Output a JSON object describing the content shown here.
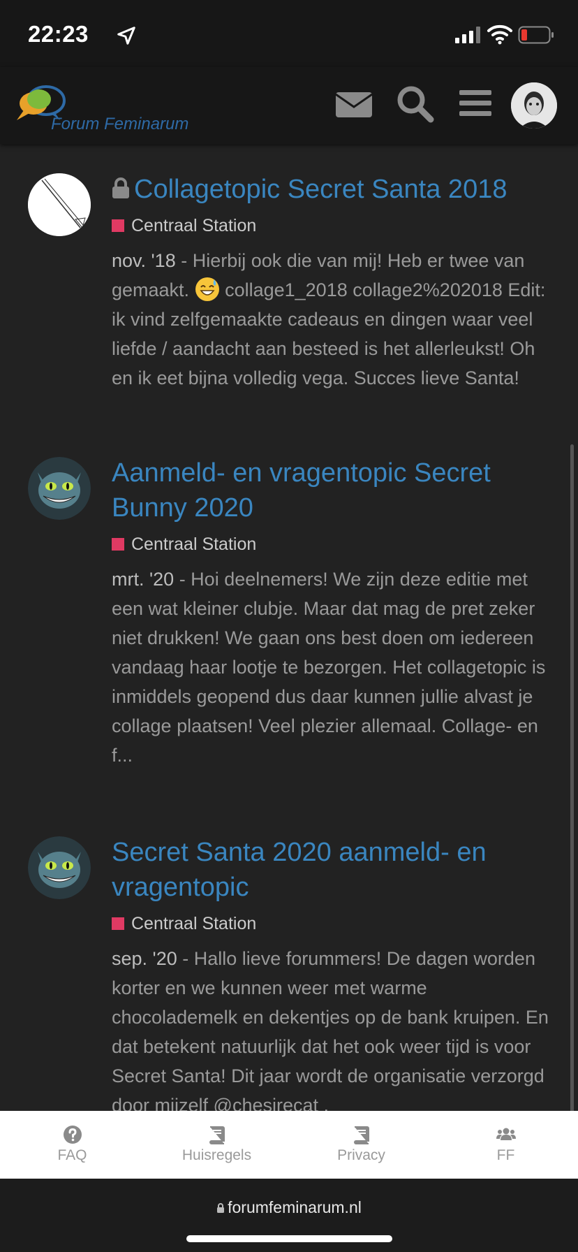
{
  "status_bar": {
    "time": "22:23",
    "icons": [
      "location-arrow-icon",
      "cellular-signal-icon",
      "wifi-icon",
      "battery-low-icon"
    ]
  },
  "header": {
    "logo_text": "Forum Feminarum",
    "icons": [
      "envelope-icon",
      "search-icon",
      "hamburger-menu-icon",
      "user-avatar"
    ]
  },
  "posts": [
    {
      "title": "Collagetopic Secret Santa 2018",
      "locked": true,
      "category": "Centraal Station",
      "date": "nov. '18",
      "excerpt_a": " - Hierbij ook die van mij! Heb er twee van gemaakt. ",
      "excerpt_b": " collage1_2018 collage2%202018 Edit: ik vind zelfgemaakte cadeaus en dingen waar veel liefde / aandacht aan besteed is het allerleukst! Oh en ik eet bijna volledig vega. Succes lieve Santa!"
    },
    {
      "title": "Aanmeld- en vragentopic Secret Bunny 2020",
      "locked": false,
      "category": "Centraal Station",
      "date": "mrt. '20",
      "excerpt": " - Hoi deelnemers! We zijn deze editie met een wat kleiner clubje. Maar dat mag de pret zeker niet drukken! We gaan ons best doen om iedereen vandaag haar lootje te bezorgen. Het collagetopic is inmiddels geopend dus daar kunnen jullie alvast je collage plaatsen! Veel plezier allemaal. Collage- en f..."
    },
    {
      "title": "Secret Santa 2020 aanmeld- en vragentopic",
      "locked": false,
      "category": "Centraal Station",
      "date": "sep. '20",
      "excerpt": " - Hallo lieve forummers! De dagen worden korter en we kunnen weer met warme chocolademelk en dekentjes op de bank kruipen. En dat betekent natuurlijk dat het ook weer tijd is voor Secret Santa! Dit jaar wordt de organisatie verzorgd door mijzelf @chesirecat ,"
    }
  ],
  "bottom_nav": [
    {
      "label": "FAQ",
      "icon": "question-circle-icon"
    },
    {
      "label": "Huisregels",
      "icon": "book-icon"
    },
    {
      "label": "Privacy",
      "icon": "book-icon"
    },
    {
      "label": "FF",
      "icon": "users-icon"
    }
  ],
  "browser": {
    "url": "forumfeminarum.nl"
  },
  "colors": {
    "link": "#3a86c0",
    "category": "#e03a63",
    "background": "#222222"
  }
}
